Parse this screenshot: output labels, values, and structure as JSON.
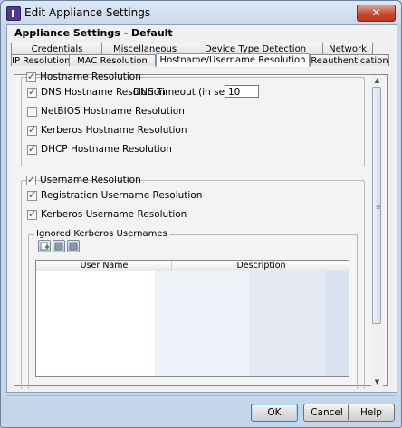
{
  "window": {
    "title": "Edit Appliance Settings",
    "close_glyph": "✕"
  },
  "heading": "Appliance Settings - Default",
  "tabs": {
    "row1": [
      "Credentials",
      "Miscellaneous",
      "Device Type Detection",
      "Network"
    ],
    "row2": [
      "IP Resolution",
      "MAC Resolution",
      "Hostname/Username Resolution",
      "Reauthentication"
    ],
    "selected": "Hostname/Username Resolution"
  },
  "hostname": {
    "label": "Hostname Resolution",
    "checked": true,
    "dns": {
      "label": "DNS Hostname Resolution",
      "checked": true,
      "timeout_label": "DNS Timeout (in seconds):",
      "timeout_value": "10"
    },
    "netbios": {
      "label": "NetBIOS Hostname Resolution",
      "checked": false
    },
    "kerberos": {
      "label": "Kerberos Hostname Resolution",
      "checked": true
    },
    "dhcp": {
      "label": "DHCP Hostname Resolution",
      "checked": true
    }
  },
  "username": {
    "label": "Username Resolution",
    "checked": true,
    "registration": {
      "label": "Registration Username Resolution",
      "checked": true
    },
    "kerberos": {
      "label": "Kerberos Username Resolution",
      "checked": true
    },
    "ignored": {
      "label": "Ignored Kerberos Usernames",
      "toolbar_icons": [
        "add-icon",
        "edit-icon",
        "delete-icon"
      ],
      "columns": [
        "User Name",
        "Description"
      ]
    }
  },
  "buttons": {
    "ok": "OK",
    "cancel": "Cancel",
    "help": "Help"
  },
  "colors": {
    "accent": "#3c7fb1",
    "close": "#c9492f"
  }
}
